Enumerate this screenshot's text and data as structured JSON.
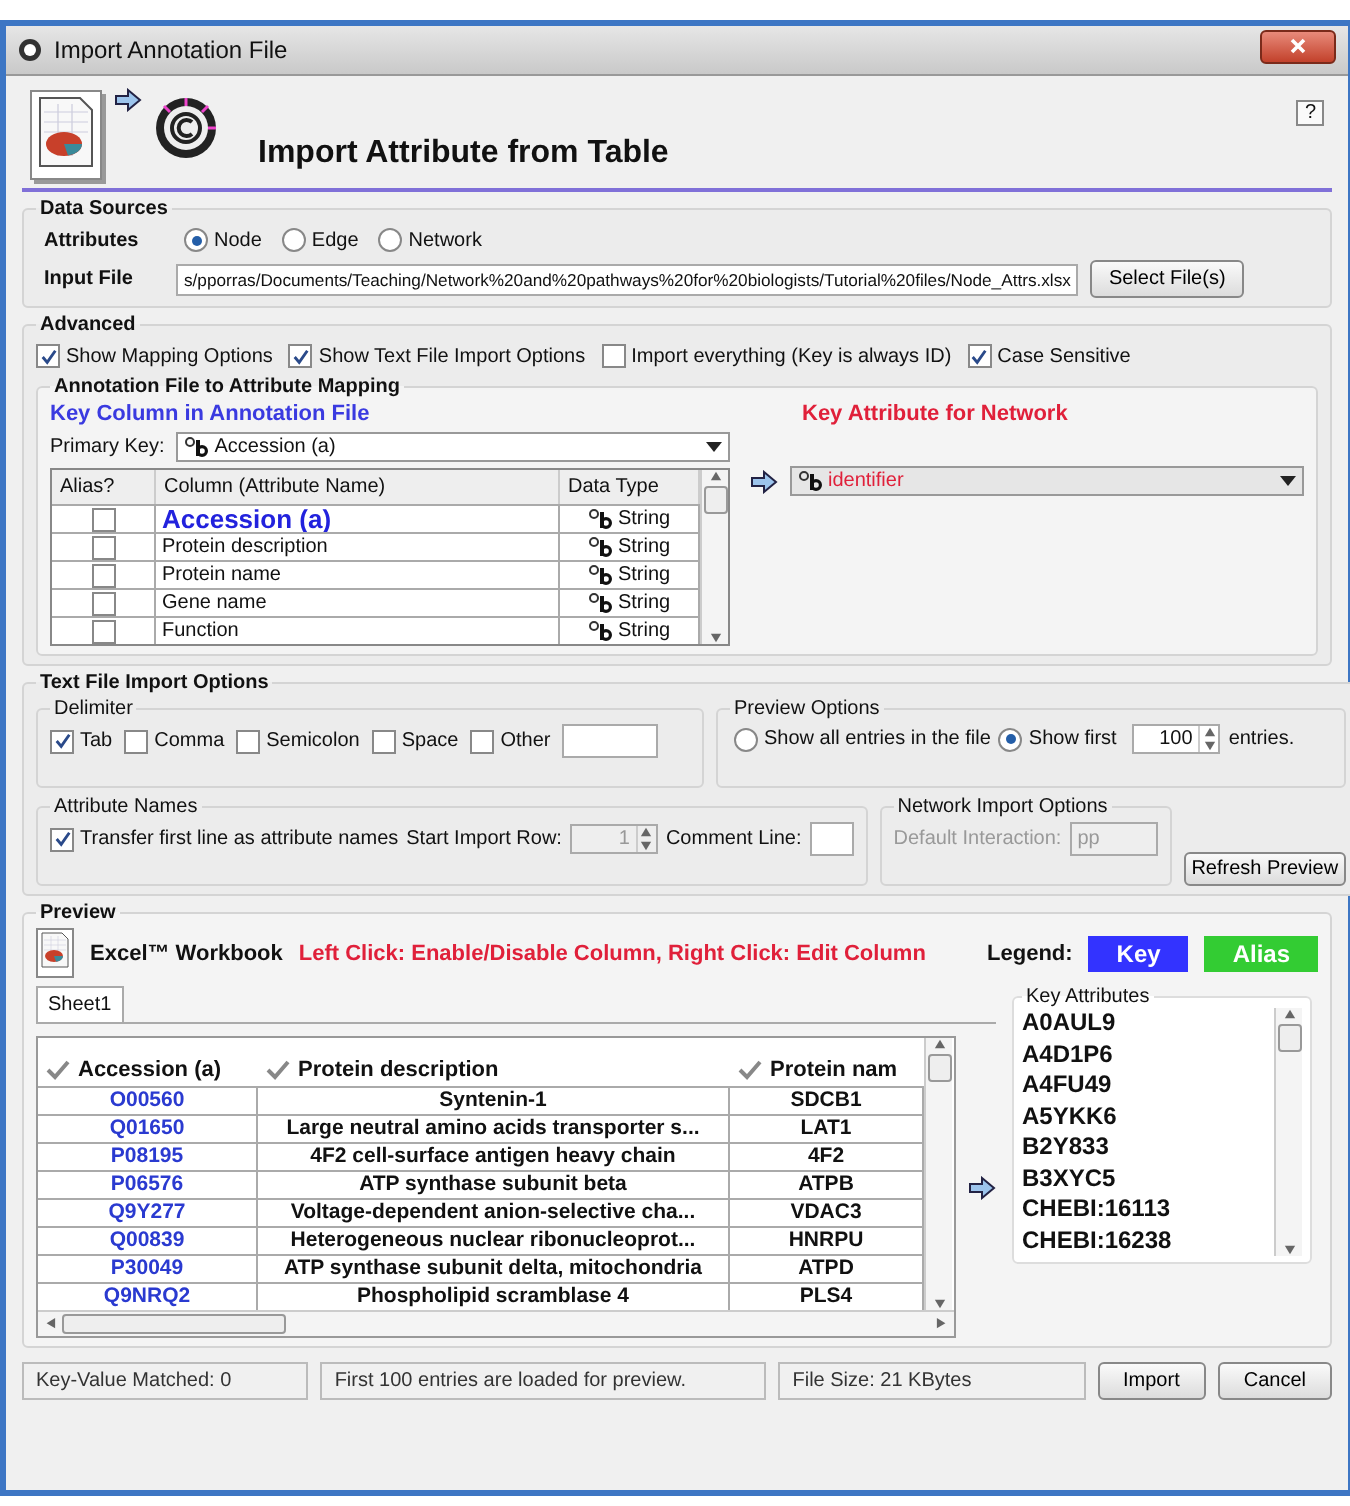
{
  "window": {
    "title": "Import Annotation File",
    "help": "?"
  },
  "header": {
    "title": "Import Attribute from Table"
  },
  "data_sources": {
    "title": "Data Sources",
    "attributes_label": "Attributes",
    "attribute_types": [
      {
        "label": "Node",
        "selected": true
      },
      {
        "label": "Edge",
        "selected": false
      },
      {
        "label": "Network",
        "selected": false
      }
    ],
    "input_file_label": "Input File",
    "input_file_value": "s/pporras/Documents/Teaching/Network%20and%20pathways%20for%20biologists/Tutorial%20files/Node_Attrs.xlsx",
    "select_button": "Select File(s)"
  },
  "advanced": {
    "title": "Advanced",
    "options": [
      {
        "label": "Show Mapping Options",
        "checked": true
      },
      {
        "label": "Show Text File Import Options",
        "checked": true
      },
      {
        "label": "Import everything (Key is always ID)",
        "checked": false
      },
      {
        "label": "Case Sensitive",
        "checked": true
      }
    ],
    "mapping": {
      "title": "Annotation File to Attribute Mapping",
      "key_column_title": "Key Column in Annotation File",
      "key_attribute_title": "Key Attribute for Network",
      "primary_key_label": "Primary Key:",
      "primary_key_value": "Accession (a)",
      "columns": [
        "Alias?",
        "Column (Attribute Name)",
        "Data Type"
      ],
      "rows": [
        {
          "alias": false,
          "key": true,
          "name": "Accession (a)",
          "type": "String"
        },
        {
          "alias": false,
          "key": false,
          "name": "Protein description",
          "type": "String"
        },
        {
          "alias": false,
          "key": false,
          "name": "Protein name",
          "type": "String"
        },
        {
          "alias": false,
          "key": false,
          "name": "Gene name",
          "type": "String"
        },
        {
          "alias": false,
          "key": false,
          "name": "Function",
          "type": "String"
        }
      ],
      "key_attribute_value": "identifier"
    }
  },
  "text_import": {
    "title": "Text File Import Options",
    "delimiter": {
      "title": "Delimiter",
      "options": [
        {
          "label": "Tab",
          "checked": true
        },
        {
          "label": "Comma",
          "checked": false
        },
        {
          "label": "Semicolon",
          "checked": false
        },
        {
          "label": "Space",
          "checked": false
        },
        {
          "label": "Other",
          "checked": false
        }
      ]
    },
    "preview_options": {
      "title": "Preview Options",
      "options": [
        {
          "label": "Show all entries in the file",
          "selected": false
        },
        {
          "label": "Show first",
          "selected": true
        }
      ],
      "count": "100",
      "suffix": "entries."
    },
    "attribute_names": {
      "title": "Attribute Names",
      "transfer_label": "Transfer first line as attribute names",
      "transfer_checked": true,
      "start_row_label": "Start Import Row:",
      "start_row_value": "1",
      "start_row_disabled": true,
      "comment_label": "Comment Line:"
    },
    "network_import": {
      "title": "Network Import Options",
      "interaction_label": "Default Interaction:",
      "interaction_value": "pp",
      "disabled": true
    },
    "refresh_button": "Refresh Preview"
  },
  "preview": {
    "title": "Preview",
    "file_type": "Excel™ Workbook",
    "hint": "Left Click: Enable/Disable Column, Right Click: Edit Column",
    "legend_label": "Legend:",
    "legend": [
      {
        "label": "Key",
        "color": "#3333ff"
      },
      {
        "label": "Alias",
        "color": "#33cc33"
      }
    ],
    "tabs": [
      {
        "label": "Sheet1",
        "selected": true
      }
    ],
    "table": {
      "columns": [
        {
          "label": "Accession (a)",
          "enabled": true
        },
        {
          "label": "Protein description",
          "enabled": true
        },
        {
          "label": "Protein nam",
          "enabled": true
        }
      ],
      "rows": [
        [
          "O00560",
          "Syntenin-1",
          "SDCB1"
        ],
        [
          "Q01650",
          "Large neutral amino acids transporter s...",
          "LAT1"
        ],
        [
          "P08195",
          "4F2 cell-surface antigen heavy chain",
          "4F2"
        ],
        [
          "P06576",
          "ATP synthase subunit beta",
          "ATPB"
        ],
        [
          "Q9Y277",
          "Voltage-dependent anion-selective cha...",
          "VDAC3"
        ],
        [
          "Q00839",
          "Heterogeneous nuclear ribonucleoprot...",
          "HNRPU"
        ],
        [
          "P30049",
          "ATP synthase subunit delta, mitochondria",
          "ATPD"
        ],
        [
          "Q9NRQ2",
          "Phospholipid scramblase 4",
          "PLS4"
        ]
      ]
    },
    "key_attributes": {
      "title": "Key Attributes",
      "items": [
        "A0AUL9",
        "A4D1P6",
        "A4FU49",
        "A5YKK6",
        "B2Y833",
        "B3XYC5",
        "CHEBI:16113",
        "CHEBI:16238"
      ]
    }
  },
  "status": {
    "matched": "Key-Value Matched: 0",
    "loaded": "First 100 entries are loaded for preview.",
    "file_size": "File Size: 21 KBytes"
  },
  "buttons": [
    "Import",
    "Cancel"
  ]
}
